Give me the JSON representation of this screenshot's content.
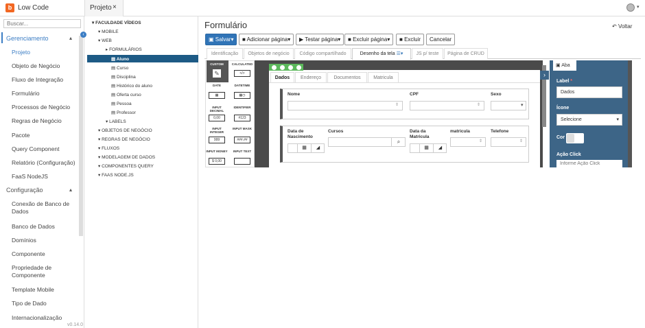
{
  "app": {
    "title": "Low Code",
    "logo_letter": "b",
    "tab": "Projeto",
    "tab_close": "×"
  },
  "sidebar": {
    "search_placeholder": "Buscar...",
    "section1": "Gerenciamento",
    "section1_items": [
      "Projeto",
      "Objeto de Negócio",
      "Fluxo de Integração",
      "Formulário",
      "Processos de Negócio",
      "Regras de Negócio",
      "Pacote",
      "Query Component",
      "Relatório (Configuração)",
      "FaaS NodeJS"
    ],
    "section2": "Configuração",
    "section2_items": [
      "Conexão de Banco de Dados",
      "Banco de Dados",
      "Domínios",
      "Componente",
      "Propriedade de Componente",
      "Template Mobile",
      "Tipo de Dado",
      "Internacionalização"
    ],
    "version": "v0.14.0"
  },
  "tree": {
    "root": "FACULDADE VÍDEOS",
    "mobile": "MOBILE",
    "web": "WEB",
    "formularios": "FORMULÁRIOS",
    "forms": [
      "Aluno",
      "Curso",
      "Disciplina",
      "Histórico do aluno",
      "Oferta curso",
      "Pessoa",
      "Professor"
    ],
    "labels": "LABELS",
    "others": [
      "OBJETOS DE NEGÓCIO",
      "REGRAS DE NEGÓCIO",
      "FLUXOS",
      "MODELAGEM DE DADOS",
      "COMPONENTES QUERY",
      "FAAS NODE.JS"
    ]
  },
  "main": {
    "title": "Formulário",
    "voltar": "Voltar",
    "buttons": {
      "save": "Salvar",
      "add_page": "Adicionar página",
      "test_page": "Testar página",
      "delete_page": "Excluir página",
      "delete": "Excluir",
      "cancel": "Cancelar"
    },
    "tabs": [
      "Identificação",
      "Objetos de negócio",
      "Código compartilhado",
      "Desenho da tela",
      "JS p/ teste",
      "Página de CRUD"
    ]
  },
  "palette": [
    {
      "label": "CUSTOM",
      "icon": "✎"
    },
    {
      "label": "CALCULATED",
      "icon": "</>"
    },
    {
      "label": "DATE",
      "icon": "▦"
    },
    {
      "label": "DATETIME",
      "icon": "▦◷"
    },
    {
      "label": "INPUT DECIMAL",
      "icon": "0,00"
    },
    {
      "label": "IDENTIFIER",
      "icon": "#123"
    },
    {
      "label": "INPUT INTEGER",
      "icon": "999"
    },
    {
      "label": "INPUT MASK",
      "icon": "###.##"
    },
    {
      "label": "INPUT MONEY",
      "icon": "$ 0,00"
    },
    {
      "label": "INPUT TEXT",
      "icon": ""
    }
  ],
  "form": {
    "tabs": [
      "Dados",
      "Endereço",
      "Documentos",
      "Matricula"
    ],
    "row1": {
      "nome": "Nome",
      "cpf": "CPF",
      "sexo": "Sexo"
    },
    "row2": {
      "nascimento": "Data de Nascimento",
      "cursos": "Cursos",
      "matricula_date": "Data da Matricula",
      "matricula": "matricula",
      "telefone": "Telefone"
    }
  },
  "props": {
    "tab": "Aba",
    "label_title": "Label",
    "label_value": "Dados",
    "icone_title": "Ícone",
    "icone_value": "Selecione",
    "cor_title": "Cor",
    "acao_title": "Ação Click",
    "acao_placeholder": "Informe Ação Click"
  }
}
